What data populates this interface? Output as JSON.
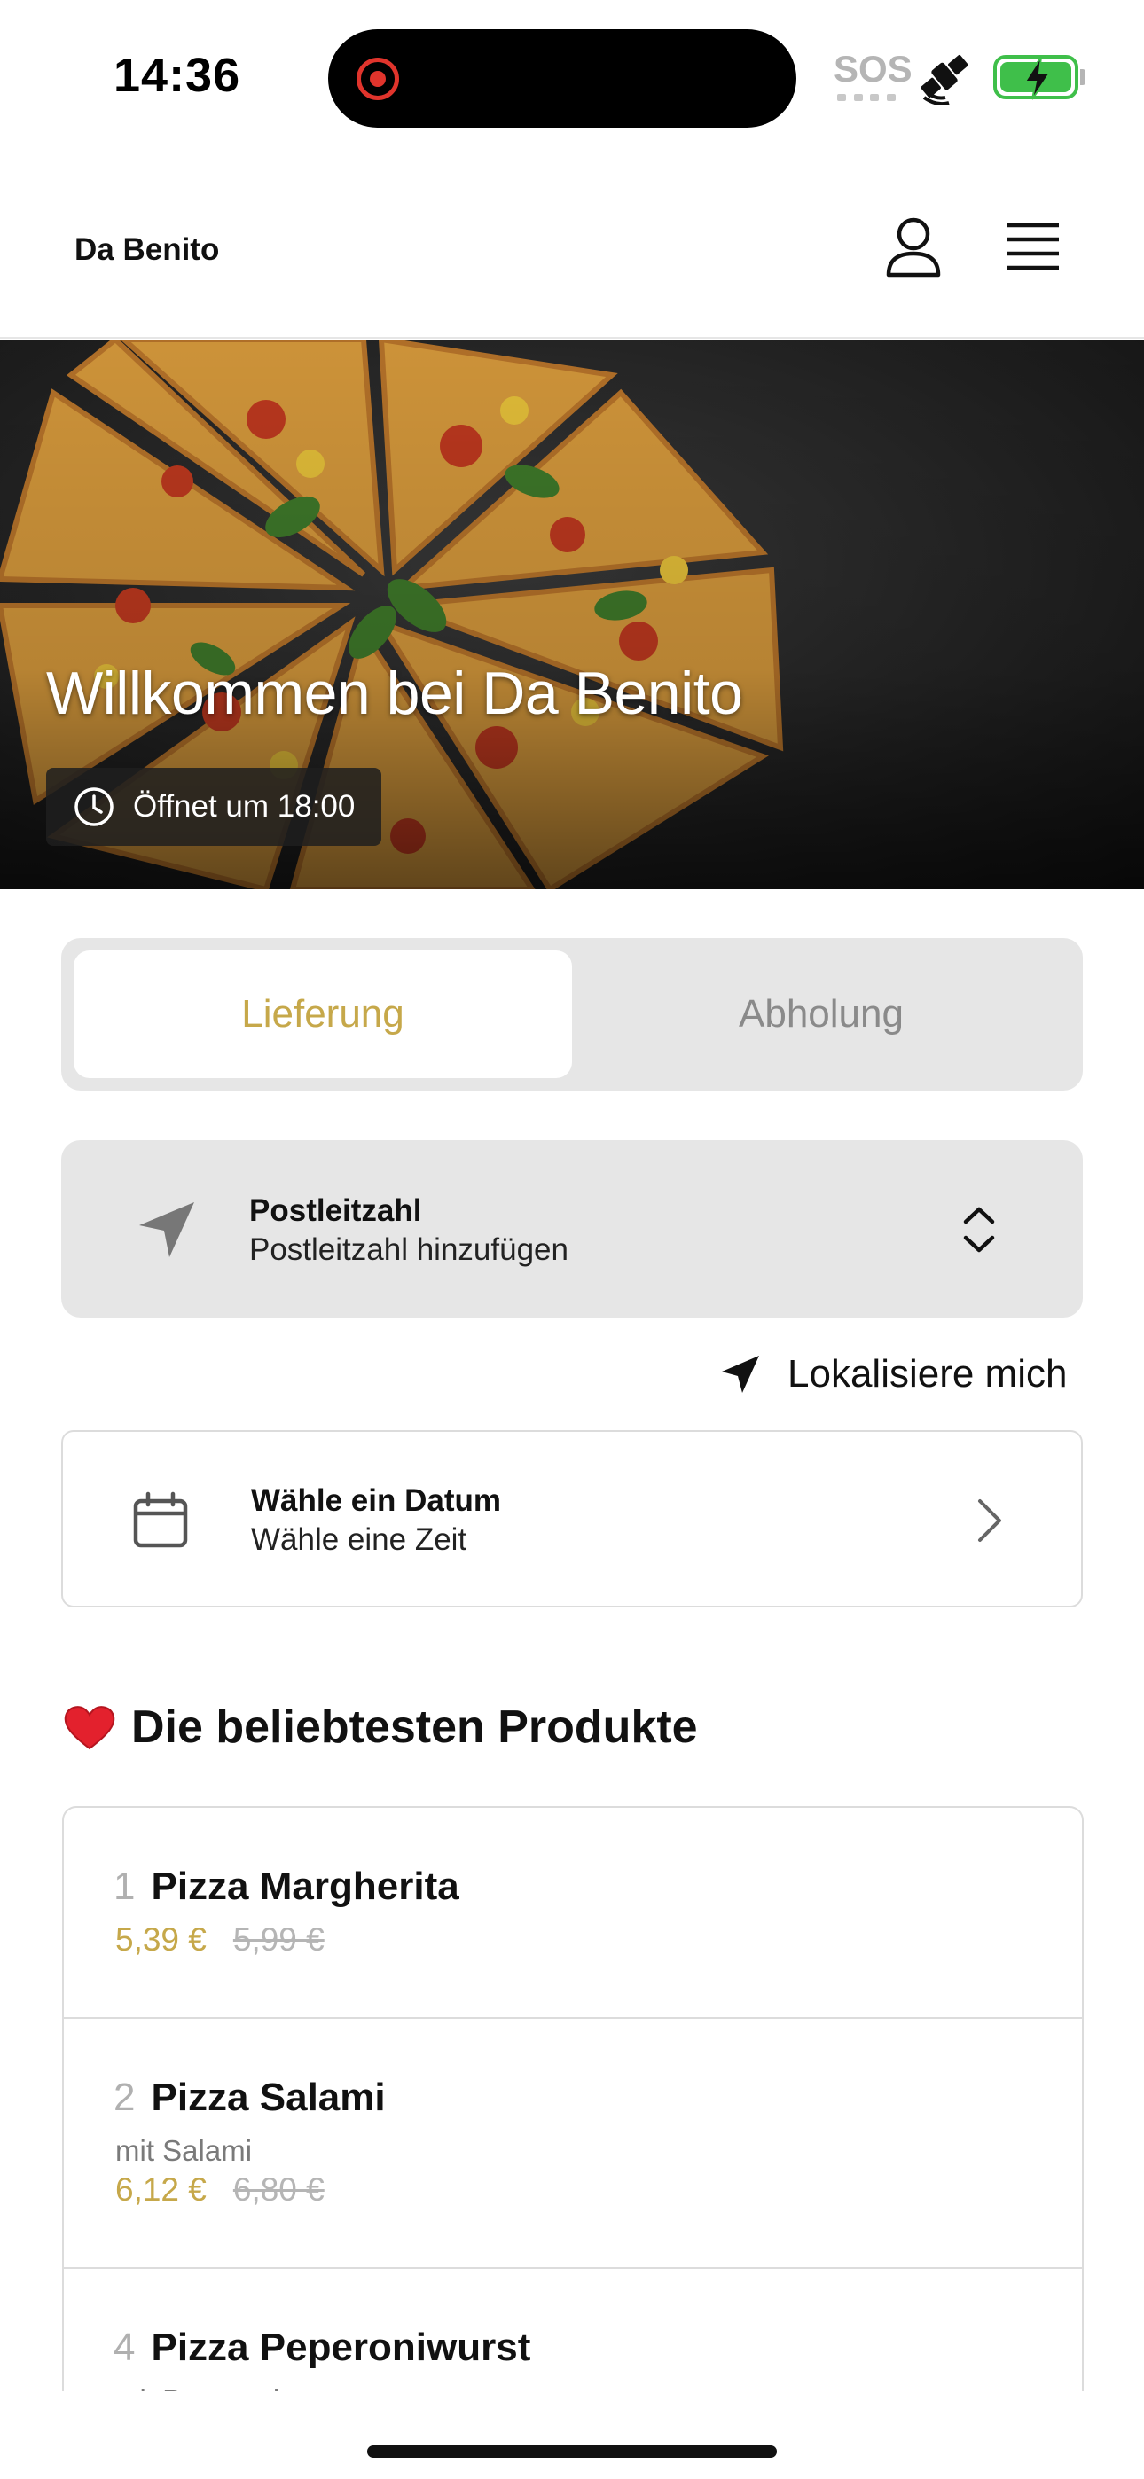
{
  "status_bar": {
    "time": "14:36",
    "sos": "SOS",
    "icons": [
      "screen-record-icon",
      "satellite-icon",
      "battery-charging-icon"
    ]
  },
  "header": {
    "brand": "Da Benito",
    "icons": [
      "person-icon",
      "menu-icon"
    ]
  },
  "hero": {
    "title": "Willkommen bei Da Benito",
    "hours": "Öffnet um 18:00"
  },
  "mode_toggle": {
    "delivery": "Lieferung",
    "pickup": "Abholung",
    "selected": "Lieferung"
  },
  "postal": {
    "label": "Postleitzahl",
    "value": "Postleitzahl hinzufügen"
  },
  "locate": {
    "label": "Lokalisiere mich"
  },
  "date": {
    "label": "Wähle ein Datum",
    "value": "Wähle eine Zeit"
  },
  "popular": {
    "title": "Die beliebtesten Produkte",
    "products": [
      {
        "rank": "1",
        "name": "Pizza Margherita",
        "description": "",
        "price": "5,39 €",
        "old_price": "5,99 €"
      },
      {
        "rank": "2",
        "name": "Pizza Salami",
        "description": "mit Salami",
        "price": "6,12 €",
        "old_price": "6,80 €"
      },
      {
        "rank": "4",
        "name": "Pizza Peperoniwurst",
        "description": "mit Peperoniwurst",
        "price": "",
        "old_price": ""
      }
    ]
  },
  "colors": {
    "accent": "#c6a84a",
    "muted_bg": "#e6e6e6",
    "record": "#e0342c",
    "battery": "#3fbf4a"
  }
}
